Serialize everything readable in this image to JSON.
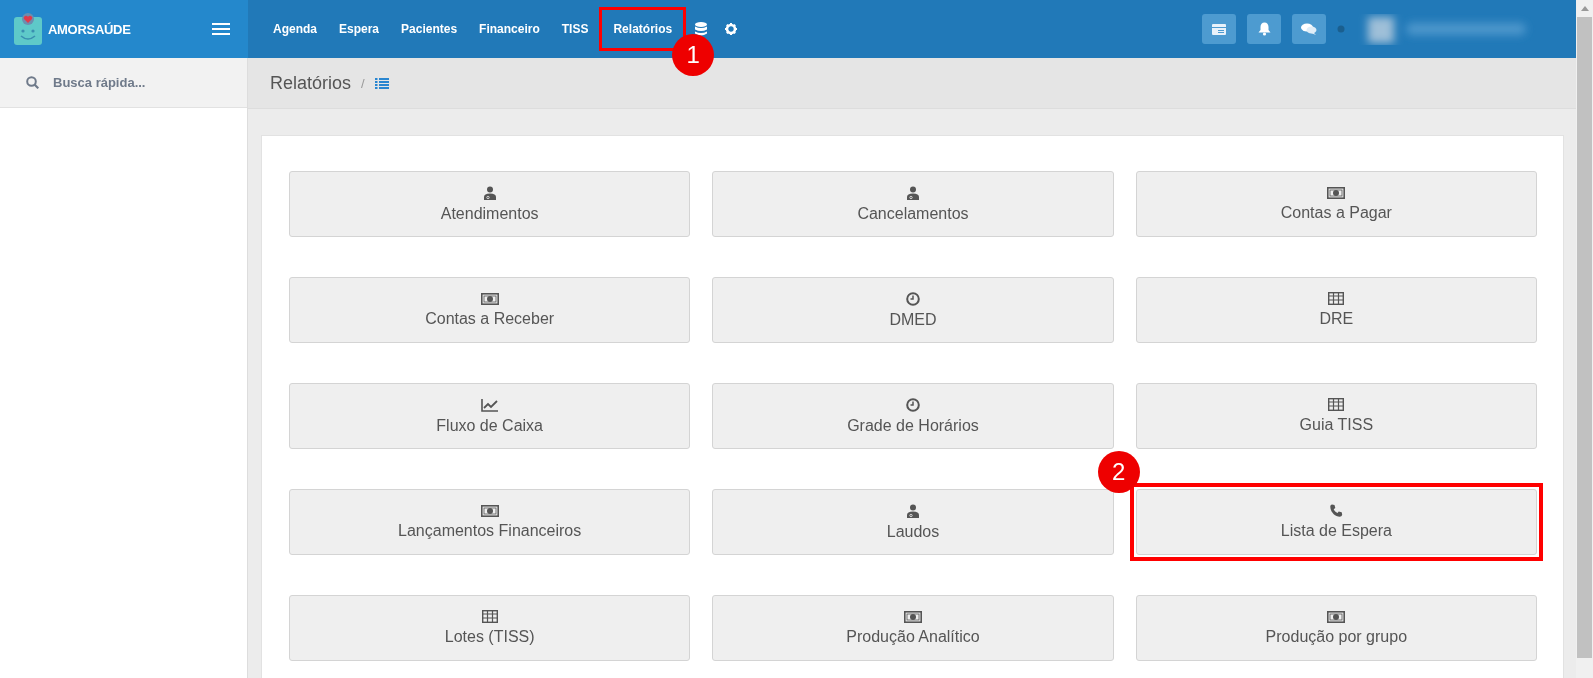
{
  "logo": {
    "text": "AMORSAÚDE"
  },
  "nav": [
    {
      "label": "Agenda"
    },
    {
      "label": "Espera"
    },
    {
      "label": "Pacientes"
    },
    {
      "label": "Financeiro"
    },
    {
      "label": "TISS"
    },
    {
      "label": "Relatórios",
      "callout": "1"
    }
  ],
  "sidebar": {
    "search_placeholder": "Busca rápida..."
  },
  "breadcrumb": {
    "title": "Relatórios",
    "separator": "/"
  },
  "tiles": [
    {
      "label": "Atendimentos",
      "kind": "doctor"
    },
    {
      "label": "Cancelamentos",
      "kind": "doctor"
    },
    {
      "label": "Contas a Pagar",
      "kind": "money"
    },
    {
      "label": "Contas a Receber",
      "kind": "money"
    },
    {
      "label": "DMED",
      "kind": "clock"
    },
    {
      "label": "DRE",
      "kind": "table"
    },
    {
      "label": "Fluxo de Caixa",
      "kind": "chart"
    },
    {
      "label": "Grade de Horários",
      "kind": "clock"
    },
    {
      "label": "Guia TISS",
      "kind": "table"
    },
    {
      "label": "Lançamentos Financeiros",
      "kind": "money"
    },
    {
      "label": "Laudos",
      "kind": "doctor"
    },
    {
      "label": "Lista de Espera",
      "kind": "phone",
      "callout": "2"
    },
    {
      "label": "Lotes (TISS)",
      "kind": "table"
    },
    {
      "label": "Produção Analítico",
      "kind": "money"
    },
    {
      "label": "Produção por grupo",
      "kind": "money"
    }
  ]
}
